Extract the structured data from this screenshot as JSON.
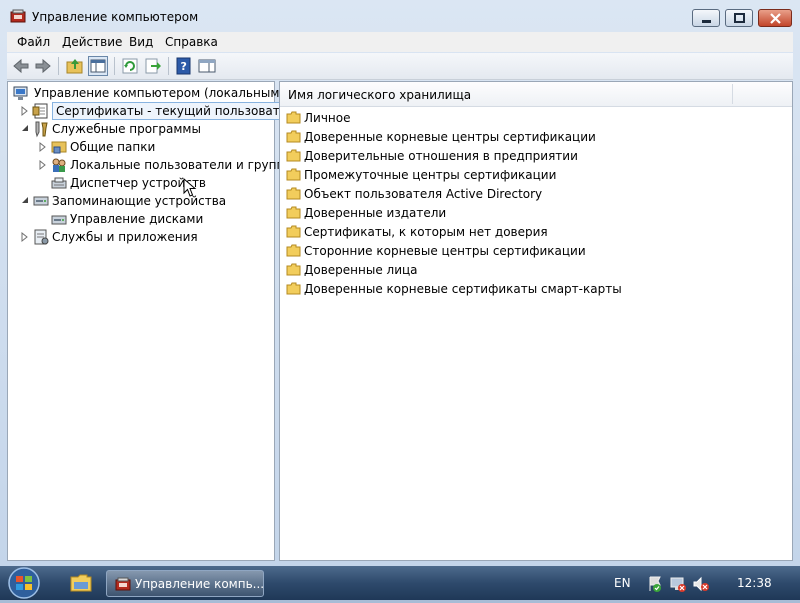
{
  "window": {
    "title": "Управление компьютером"
  },
  "menu": [
    "Файл",
    "Действие",
    "Вид",
    "Справка"
  ],
  "tree": [
    {
      "label": "Управление компьютером (локальным)",
      "icon": "computer-management-icon"
    },
    {
      "label": "Сертификаты - текущий пользователь",
      "icon": "certificates-icon",
      "selected": true
    },
    {
      "label": "Служебные программы",
      "icon": "system-tools-icon"
    },
    {
      "label": "Общие папки",
      "icon": "shared-folders-icon"
    },
    {
      "label": "Локальные пользователи и группы",
      "icon": "local-users-icon"
    },
    {
      "label": "Диспетчер устройств",
      "icon": "device-manager-icon"
    },
    {
      "label": "Запоминающие устройства",
      "icon": "storage-icon"
    },
    {
      "label": "Управление дисками",
      "icon": "disk-management-icon"
    },
    {
      "label": "Службы и приложения",
      "icon": "services-icon"
    }
  ],
  "list": {
    "column_header": "Имя логического хранилища",
    "items": [
      "Личное",
      "Доверенные корневые центры сертификации",
      "Доверительные отношения в предприятии",
      "Промежуточные центры сертификации",
      "Объект пользователя Active Directory",
      "Доверенные издатели",
      "Сертификаты, к которым нет доверия",
      "Сторонние корневые центры сертификации",
      "Доверенные лица",
      "Доверенные корневые сертификаты смарт-карты"
    ]
  },
  "taskbar": {
    "task_label": "Управление компь...",
    "language": "EN",
    "clock": "12:38"
  }
}
